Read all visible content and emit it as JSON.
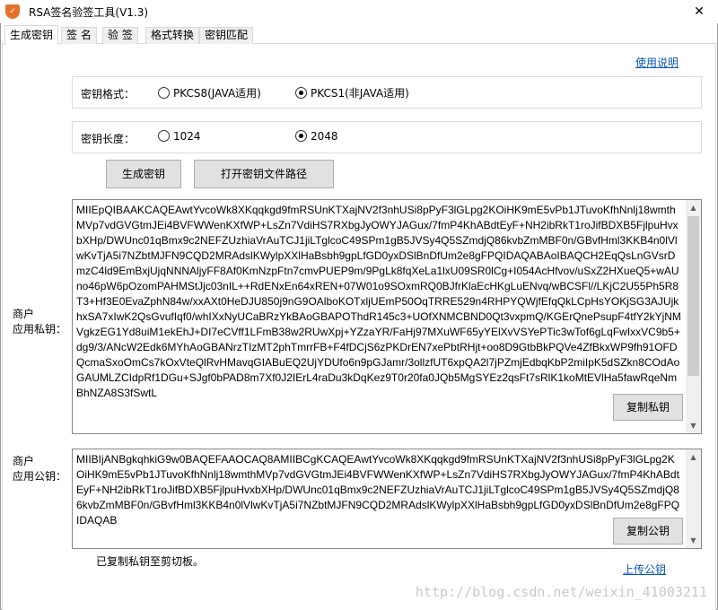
{
  "window": {
    "title": "RSA签名验签工具(V1.3)",
    "app_icon": "shield-icon",
    "close_glyph": "✕"
  },
  "tabs": [
    {
      "label": "生成密钥",
      "active": true
    },
    {
      "label": "签 名",
      "active": false
    },
    {
      "label": "验 签",
      "active": false
    },
    {
      "label": "格式转换",
      "active": false
    },
    {
      "label": "密钥匹配",
      "active": false
    }
  ],
  "help_link": "使用说明",
  "key_format": {
    "label": "密钥格式：",
    "options": [
      {
        "label": "PKCS8(JAVA适用)",
        "checked": false
      },
      {
        "label": "PKCS1(非JAVA适用)",
        "checked": true
      }
    ]
  },
  "key_length": {
    "label": "密钥长度：",
    "options": [
      {
        "label": "1024",
        "checked": false
      },
      {
        "label": "2048",
        "checked": true
      }
    ]
  },
  "buttons": {
    "generate": "生成密钥",
    "open_path": "打开密钥文件路径",
    "copy_private": "复制私钥",
    "copy_public": "复制公钥"
  },
  "private_key": {
    "label": "商户\n应用私钥：",
    "text": "MIIEpQIBAAKCAQEAwtYvcoWk8XKqqkgd9fmRSUnKTXajNV2f3nhUSi8pPyF3lGLpg2KOiHK9mE5vPb1JTuvoKfhNnlj18wmthMVp7vdGVGtmJEi4BVFWWenKXfWP+LsZn7VdiHS7RXbgJyOWYJAGux/7fmP4KhABdtEyF+NH2ibRkT1roJifBDXB5FjlpuHvxbXHp/DWUnc01qBmx9c2NEFZUzhiaVrAuTCJ1jiLTglcoC49SPm1gB5JVSy4Q5SZmdjQ86kvbZmMBF0n/GBvfHml3KKB4n0lVlwKvTjA5i7NZbtMJFN9CQD2MRAdslKWylpXXlHaBsbh9gpLfGD0yxDSlBnDfUm2e8gFPQIDAQABAoIBAQCH2EqQsLnGVsrDmzC4ld9EmBxjUjqNNNAljyFF8Af0KmNzpFtn7cmvPUEP9m/9PgLk8fqXeLa1lxU09SR0lCg+I054AcHfvov/uSxZ2HXueQ5+wAUno46pW6pOzomPAHMStJjc03nIL++RdENxEn64xREN+07W01o9SOxmRQ0BJfrKlaEcHKgLuENvq/wBCSFl//LKjC2U55Ph5R8T3+Hf3E0EvaZphN84w/xxAXt0HeDJU850j9nG9OAlboKOTxljUEmP50OqTRRE529n4RHPYQWjfEfqQkLCpHsYOKjSG3AJUjkhxSA7xIwK2QsGvufIqf0/whIXxNyUCaBRzYkBAoGBAPOThdR145c3+UOfXNMCBND0Qt3vxpmQ/KGErQnePsupF4tfY2kYjNMVgkzEG1Yd8uiM1ekEhJ+DI7eCVff1LFmB38w2RUwXpj+YZzaYR/FaHj97MXuWF65yYElXvVSYePTic3wTof6gLqFwIxxVC9b5+dg9/3/ANcW2Edk6MYhAoGBANrzTIzMT2phTmrrFB+F4fDCjS6zPKDrEN7xePbtRHjt+oo8D9GtbBkPQVe4ZfBkxWP9fh91OFDQcmaSxoOmCs7kOxVteQlRvHMavqGIABuEQ2UjYDUfo6n9pGJamr/3ollzfUT6xpQA2l7jPZmjEdbqKbP2miIpK5dSZkn8COdAoGAUMLZCIdpRf1DGu+SJgf0bPAD8m7Xf0J2IErL4raDu3kDqKez9T0r20fa0JQb5MgSYEz2qsFt7sRlK1koMtEVlHa5fawRqeNmBhNZA8S3fSwtL"
  },
  "public_key": {
    "label": "商户\n应用公钥：",
    "text": "MIIBIjANBgkqhkiG9w0BAQEFAAOCAQ8AMIIBCgKCAQEAwtYvcoWk8XKqqkgd9fmRSUnKTXajNV2f3nhUSi8pPyF3lGLpg2KOiHK9mE5vPb1JTuvoKfhNnlj18wmthMVp7vdGVGtmJEi4BVFWWenKXfWP+LsZn7VdiHS7RXbgJyOWYJAGux/7fmP4KhABdtEyF+NH2ibRkT1roJifBDXB5FjlpuHvxbXHp/DWUnc01qBmx9c2NEFZUzhiaVrAuTCJ1jiLTglcoC49SPm1gB5JVSy4Q5SZmdjQ86kvbZmMBF0n/GBvfHml3KKB4n0lVlwKvTjA5i7NZbtMJFN9CQD2MRAdslKWylpXXlHaBsbh9gpLfGD0yxDSlBnDfUm2e8gFPQIDAQAB"
  },
  "status_text": "已复制私钥至剪切板。",
  "upload_link": "上传公钥",
  "watermark": "http://blog.csdn.net/weixin_41003211",
  "colors": {
    "link": "#0a55b8",
    "button_bg": "#e1e1e1",
    "app_icon": "#e8702a"
  }
}
